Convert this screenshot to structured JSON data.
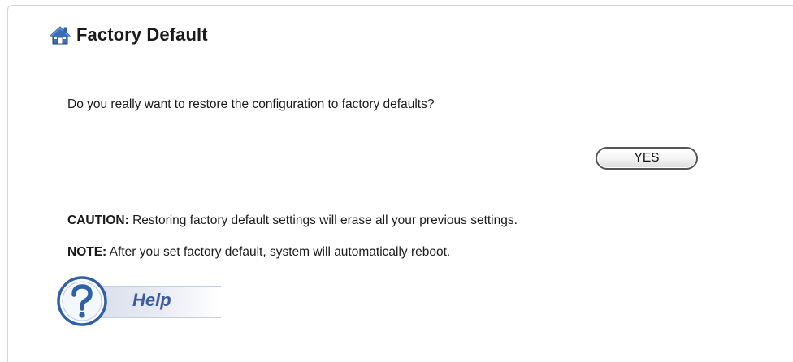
{
  "page": {
    "title": "Factory Default"
  },
  "content": {
    "question": "Do you really want to restore the configuration to factory defaults?",
    "yes_label": "YES",
    "caution_prefix": "CAUTION:",
    "caution_text": " Restoring factory default settings will erase all your previous settings.",
    "note_prefix": "NOTE:",
    "note_text": " After you set factory default, system will automatically reboot."
  },
  "help": {
    "label": "Help",
    "icon": "question-mark-icon"
  },
  "icons": {
    "title": "home-icon"
  },
  "colors": {
    "help_text": "#3d5a9e",
    "help_circle": "#2f5fa8",
    "home_icon": "#3a6fb8"
  }
}
